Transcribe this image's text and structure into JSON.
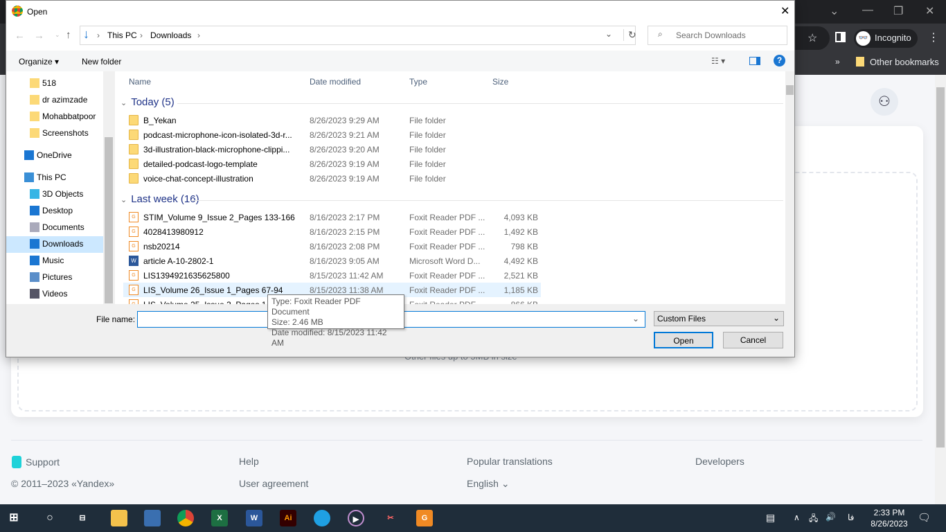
{
  "browser": {
    "profile": "Incognito",
    "other_bookmarks": "Other bookmarks"
  },
  "page": {
    "upload_hint": "Other files up to 5MB in size",
    "footer": {
      "support": "Support",
      "help": "Help",
      "popular": "Popular translations",
      "developers": "Developers",
      "copyright": "© 2011–2023 «Yandex»",
      "agreement": "User agreement",
      "language": "English"
    }
  },
  "dialog": {
    "title": "Open",
    "breadcrumb": [
      "This PC",
      "Downloads"
    ],
    "search_placeholder": "Search Downloads",
    "organize": "Organize",
    "new_folder": "New folder",
    "nav": [
      {
        "label": "518",
        "icon": "folder"
      },
      {
        "label": "dr azimzade",
        "icon": "folder"
      },
      {
        "label": "Mohabbatpoor",
        "icon": "folder"
      },
      {
        "label": "Screenshots",
        "icon": "folder"
      },
      {
        "label": "OneDrive",
        "icon": "cloud"
      },
      {
        "label": "This PC",
        "icon": "pc"
      },
      {
        "label": "3D Objects",
        "icon": "cube"
      },
      {
        "label": "Desktop",
        "icon": "desktop"
      },
      {
        "label": "Documents",
        "icon": "documents"
      },
      {
        "label": "Downloads",
        "icon": "download"
      },
      {
        "label": "Music",
        "icon": "music"
      },
      {
        "label": "Pictures",
        "icon": "pictures"
      },
      {
        "label": "Videos",
        "icon": "videos"
      }
    ],
    "columns": {
      "name": "Name",
      "date": "Date modified",
      "type": "Type",
      "size": "Size"
    },
    "groups": [
      {
        "label": "Today (5)",
        "files": [
          {
            "name": "B_Yekan",
            "date": "8/26/2023 9:29 AM",
            "type": "File folder",
            "size": "",
            "icon": "folder"
          },
          {
            "name": "podcast-microphone-icon-isolated-3d-r...",
            "date": "8/26/2023 9:21 AM",
            "type": "File folder",
            "size": "",
            "icon": "folder"
          },
          {
            "name": "3d-illustration-black-microphone-clippi...",
            "date": "8/26/2023 9:20 AM",
            "type": "File folder",
            "size": "",
            "icon": "folder"
          },
          {
            "name": "detailed-podcast-logo-template",
            "date": "8/26/2023 9:19 AM",
            "type": "File folder",
            "size": "",
            "icon": "folder"
          },
          {
            "name": "voice-chat-concept-illustration",
            "date": "8/26/2023 9:19 AM",
            "type": "File folder",
            "size": "",
            "icon": "folder"
          }
        ]
      },
      {
        "label": "Last week (16)",
        "files": [
          {
            "name": "STIM_Volume 9_Issue 2_Pages 133-166",
            "date": "8/16/2023 2:17 PM",
            "type": "Foxit Reader PDF ...",
            "size": "4,093 KB",
            "icon": "pdf"
          },
          {
            "name": "4028413980912",
            "date": "8/16/2023 2:15 PM",
            "type": "Foxit Reader PDF ...",
            "size": "1,492 KB",
            "icon": "pdf"
          },
          {
            "name": "nsb20214",
            "date": "8/16/2023 2:08 PM",
            "type": "Foxit Reader PDF ...",
            "size": "798 KB",
            "icon": "pdf"
          },
          {
            "name": "article A-10-2802-1",
            "date": "8/16/2023 9:05 AM",
            "type": "Microsoft Word D...",
            "size": "4,492 KB",
            "icon": "word"
          },
          {
            "name": "LIS1394921635625800",
            "date": "8/15/2023 11:42 AM",
            "type": "Foxit Reader PDF ...",
            "size": "2,521 KB",
            "icon": "pdf"
          },
          {
            "name": "LIS_Volume 26_Issue 1_Pages 67-94",
            "date": "8/15/2023 11:38 AM",
            "type": "Foxit Reader PDF ...",
            "size": "1,185 KB",
            "icon": "pdf"
          },
          {
            "name": "LIS_Volume 25_Issue 3_Pages 143-1...",
            "date": "",
            "type": "Foxit Reader PDF ...",
            "size": "866 KB",
            "icon": "pdf"
          }
        ]
      }
    ],
    "tooltip": {
      "type": "Type: Foxit Reader PDF Document",
      "size": "Size: 2.46 MB",
      "date": "Date modified: 8/15/2023 11:42 AM"
    },
    "file_name_label": "File name:",
    "file_name_value": "",
    "filter": "Custom Files",
    "open": "Open",
    "cancel": "Cancel"
  },
  "taskbar": {
    "time": "2:33 PM",
    "date": "8/26/2023",
    "lang": "فا"
  }
}
